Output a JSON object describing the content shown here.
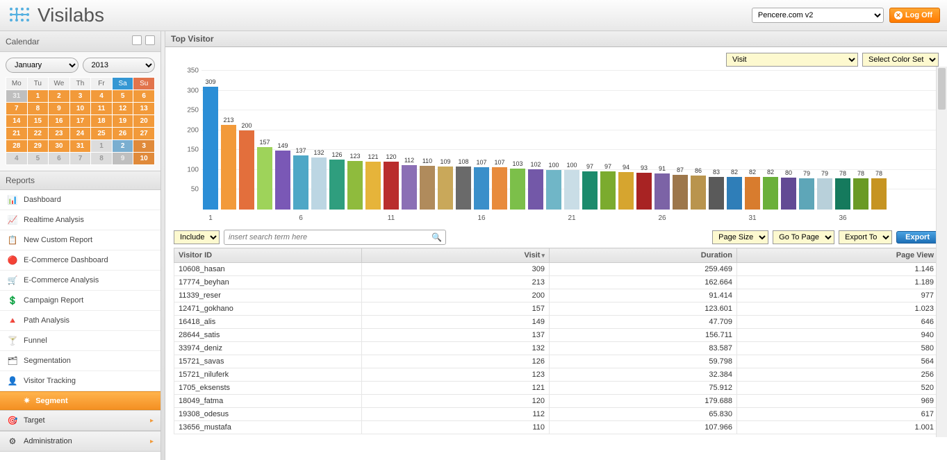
{
  "header": {
    "brand": "Visilabs",
    "site_selected": "Pencere.com v2",
    "logoff_label": "Log Off"
  },
  "calendar": {
    "title": "Calendar",
    "month": "January",
    "year": "2013",
    "days": [
      "Mo",
      "Tu",
      "We",
      "Th",
      "Fr",
      "Sa",
      "Su"
    ],
    "weeks": [
      [
        {
          "d": "31",
          "c": "dim"
        },
        {
          "d": "1",
          "c": ""
        },
        {
          "d": "2",
          "c": ""
        },
        {
          "d": "3",
          "c": ""
        },
        {
          "d": "4",
          "c": ""
        },
        {
          "d": "5",
          "c": ""
        },
        {
          "d": "6",
          "c": ""
        }
      ],
      [
        {
          "d": "7",
          "c": ""
        },
        {
          "d": "8",
          "c": ""
        },
        {
          "d": "9",
          "c": ""
        },
        {
          "d": "10",
          "c": ""
        },
        {
          "d": "11",
          "c": ""
        },
        {
          "d": "12",
          "c": ""
        },
        {
          "d": "13",
          "c": ""
        }
      ],
      [
        {
          "d": "14",
          "c": ""
        },
        {
          "d": "15",
          "c": ""
        },
        {
          "d": "16",
          "c": ""
        },
        {
          "d": "17",
          "c": ""
        },
        {
          "d": "18",
          "c": ""
        },
        {
          "d": "19",
          "c": ""
        },
        {
          "d": "20",
          "c": ""
        }
      ],
      [
        {
          "d": "21",
          "c": ""
        },
        {
          "d": "22",
          "c": ""
        },
        {
          "d": "23",
          "c": ""
        },
        {
          "d": "24",
          "c": ""
        },
        {
          "d": "25",
          "c": ""
        },
        {
          "d": "26",
          "c": ""
        },
        {
          "d": "27",
          "c": ""
        }
      ],
      [
        {
          "d": "28",
          "c": ""
        },
        {
          "d": "29",
          "c": ""
        },
        {
          "d": "30",
          "c": ""
        },
        {
          "d": "31",
          "c": ""
        },
        {
          "d": "1",
          "c": "dim2"
        },
        {
          "d": "2",
          "c": "blu"
        },
        {
          "d": "3",
          "c": "orad"
        }
      ],
      [
        {
          "d": "4",
          "c": "dim2"
        },
        {
          "d": "5",
          "c": "dim2"
        },
        {
          "d": "6",
          "c": "dim2"
        },
        {
          "d": "7",
          "c": "dim2"
        },
        {
          "d": "8",
          "c": "dim2"
        },
        {
          "d": "9",
          "c": "dim"
        },
        {
          "d": "10",
          "c": "orad"
        }
      ]
    ]
  },
  "reports": {
    "title": "Reports",
    "items": [
      {
        "icon": "📊",
        "label": "Dashboard"
      },
      {
        "icon": "📈",
        "label": "Realtime Analysis"
      },
      {
        "icon": "📋",
        "label": "New Custom Report"
      },
      {
        "icon": "🔴",
        "label": "E-Commerce Dashboard"
      },
      {
        "icon": "🛒",
        "label": "E-Commerce Analysis"
      },
      {
        "icon": "💲",
        "label": "Campaign Report"
      },
      {
        "icon": "🔺",
        "label": "Path Analysis"
      },
      {
        "icon": "🍸",
        "label": "Funnel"
      },
      {
        "icon": "🗂",
        "label": "Segmentation"
      },
      {
        "icon": "👤",
        "label": "Visitor Tracking"
      }
    ],
    "active_sub": "Segment",
    "accordions": [
      {
        "icon": "🎯",
        "label": "Target"
      },
      {
        "icon": "⚙",
        "label": "Administration"
      }
    ]
  },
  "main": {
    "title": "Top Visitor",
    "metric_selected": "Visit",
    "color_set_label": "Select Color Set",
    "y_ticks": [
      50,
      100,
      150,
      200,
      250,
      300,
      350
    ],
    "x_ticks": [
      1,
      6,
      11,
      16,
      21,
      26,
      31,
      36
    ],
    "toolbar": {
      "include_label": "Include",
      "search_placeholder": "insert search term here",
      "page_size_label": "Page Size",
      "goto_page_label": "Go To Page",
      "export_to_label": "Export To",
      "export_btn": "Export"
    },
    "columns": {
      "visitor_id": "Visitor ID",
      "visit": "Visit",
      "duration": "Duration",
      "page_view": "Page View"
    },
    "rows": [
      {
        "id": "10608_hasan",
        "visit": "309",
        "duration": "259.469",
        "pv": "1.146"
      },
      {
        "id": "17774_beyhan",
        "visit": "213",
        "duration": "162.664",
        "pv": "1.189"
      },
      {
        "id": "11339_reser",
        "visit": "200",
        "duration": "91.414",
        "pv": "977"
      },
      {
        "id": "12471_gokhano",
        "visit": "157",
        "duration": "123.601",
        "pv": "1.023"
      },
      {
        "id": "16418_alis",
        "visit": "149",
        "duration": "47.709",
        "pv": "646"
      },
      {
        "id": "28644_satis",
        "visit": "137",
        "duration": "156.711",
        "pv": "940"
      },
      {
        "id": "33974_deniz",
        "visit": "132",
        "duration": "83.587",
        "pv": "580"
      },
      {
        "id": "15721_savas",
        "visit": "126",
        "duration": "59.798",
        "pv": "564"
      },
      {
        "id": "15721_niluferk",
        "visit": "123",
        "duration": "32.384",
        "pv": "256"
      },
      {
        "id": "1705_eksensts",
        "visit": "121",
        "duration": "75.912",
        "pv": "520"
      },
      {
        "id": "18049_fatma",
        "visit": "120",
        "duration": "179.688",
        "pv": "969"
      },
      {
        "id": "19308_odesus",
        "visit": "112",
        "duration": "65.830",
        "pv": "617"
      },
      {
        "id": "13656_mustafa",
        "visit": "110",
        "duration": "107.966",
        "pv": "1.001"
      }
    ]
  },
  "chart_data": {
    "type": "bar",
    "title": "Top Visitor",
    "xlabel": "",
    "ylabel": "",
    "ylim": [
      0,
      350
    ],
    "categories_labeled": [
      1,
      6,
      11,
      16,
      21,
      26,
      31,
      36
    ],
    "values": [
      309,
      213,
      200,
      157,
      149,
      137,
      132,
      126,
      123,
      121,
      120,
      112,
      110,
      109,
      108,
      107,
      107,
      103,
      102,
      100,
      100,
      97,
      97,
      94,
      93,
      91,
      87,
      86,
      83,
      82,
      82,
      82,
      80,
      79,
      79,
      78,
      78,
      78
    ],
    "colors": [
      "#2b8ed6",
      "#f29a3a",
      "#e36f3c",
      "#9ed35a",
      "#7a58b6",
      "#4ea7c6",
      "#bcd6e3",
      "#2f9e7e",
      "#8fbb3d",
      "#e6b43a",
      "#b92d2d",
      "#8b6fb5",
      "#b08b5c",
      "#c9a85a",
      "#6a6a6a",
      "#3a8fca",
      "#e88b3c",
      "#7cbf4a",
      "#7358a8",
      "#70b6c7",
      "#c9dde6",
      "#1c8b6c",
      "#7bab2e",
      "#d6a52f",
      "#a82323",
      "#7c63a6",
      "#9d774b",
      "#b9944d",
      "#5a5a5a",
      "#2f7eb8",
      "#d87c2e",
      "#6bb03a",
      "#624a94",
      "#5ea6b8",
      "#b8d0da",
      "#157a5d",
      "#6a9a25",
      "#c69422"
    ]
  }
}
